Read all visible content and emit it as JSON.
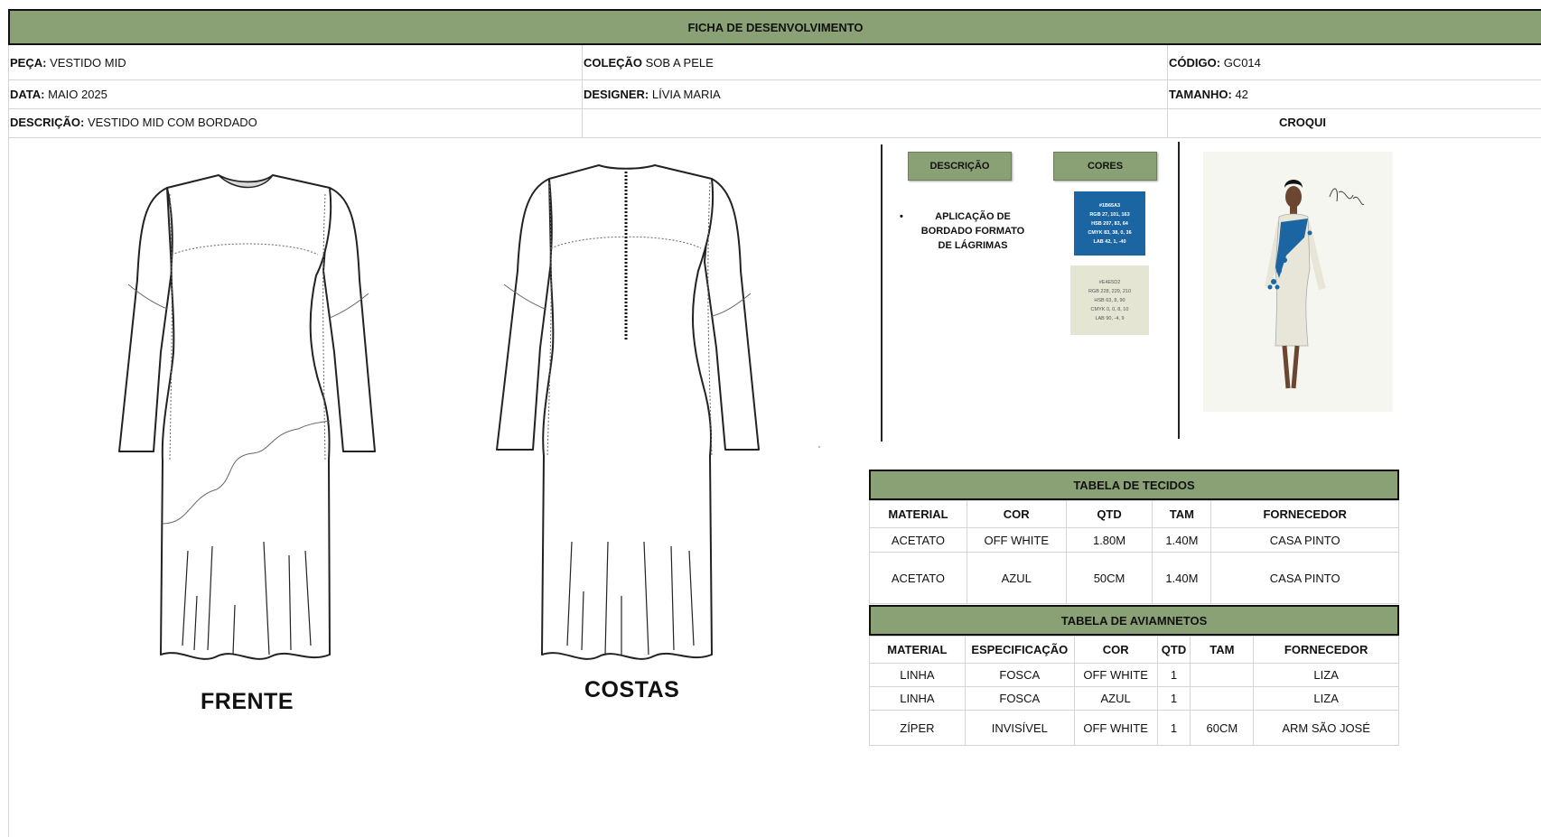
{
  "header": {
    "title": "FICHA DE DESENVOLVIMENTO"
  },
  "info": {
    "peca_label": "PEÇA:",
    "peca_value": "VESTIDO MID",
    "colecao_label": "COLEÇÃO",
    "colecao_value": "SOB A PELE",
    "codigo_label": "CÓDIGO:",
    "codigo_value": "GC014",
    "data_label": "DATA:",
    "data_value": "MAIO 2025",
    "designer_label": "DESIGNER:",
    "designer_value": "LÍVIA MARIA",
    "tamanho_label": "TAMANHO:",
    "tamanho_value": "42",
    "descricao_label": "DESCRIÇÃO:",
    "descricao_value": "VESTIDO MID COM BORDADO",
    "croqui_label": "CROQUI"
  },
  "drawings": {
    "front_label": "FRENTE",
    "back_label": "COSTAS"
  },
  "detail_panel": {
    "descricao_button": "DESCRIÇÃO",
    "cores_button": "CORES",
    "bullets": [
      "APLICAÇÃO DE BORDADO FORMATO DE LÁGRIMAS"
    ],
    "swatches": [
      {
        "color": "#1b65a3",
        "text_color": "#ffffff",
        "lines": [
          "#1B65A3",
          "RGB 27, 101, 163",
          "HSB 207, 83, 64",
          "CMYK 83, 38, 0, 36",
          "LAB 42, 1, -40"
        ]
      },
      {
        "color": "#e4e5d2",
        "text_color": "#555555",
        "lines": [
          "#E4E5D2",
          "RGB 228, 229, 210",
          "HSB 63, 8, 90",
          "CMYK 0, 0, 8, 10",
          "LAB 90, -4, 9"
        ]
      }
    ]
  },
  "fabrics": {
    "title": "TABELA DE TECIDOS",
    "headers": [
      "MATERIAL",
      "COR",
      "QTD",
      "TAM",
      "FORNECEDOR"
    ],
    "rows": [
      [
        "ACETATO",
        "OFF WHITE",
        "1.80M",
        "1.40M",
        "CASA PINTO"
      ],
      [
        "ACETATO",
        "AZUL",
        "50CM",
        "1.40M",
        "CASA PINTO"
      ]
    ]
  },
  "trims": {
    "title": "TABELA DE AVIAMNETOS",
    "headers": [
      "MATERIAL",
      "ESPECIFICAÇÃO",
      "COR",
      "QTD",
      "TAM",
      "FORNECEDOR"
    ],
    "rows": [
      [
        "LINHA",
        "FOSCA",
        "OFF WHITE",
        "1",
        "",
        "LIZA"
      ],
      [
        "LINHA",
        "FOSCA",
        "AZUL",
        "1",
        "",
        "LIZA"
      ],
      [
        "ZÍPER",
        "INVISÍVEL",
        "OFF WHITE",
        "1",
        "60CM",
        "ARM SÃO JOSÉ"
      ]
    ]
  },
  "colors": {
    "accent_green": "#8aa176",
    "swatch_blue": "#1b65a3",
    "swatch_offwhite": "#e4e5d2"
  }
}
